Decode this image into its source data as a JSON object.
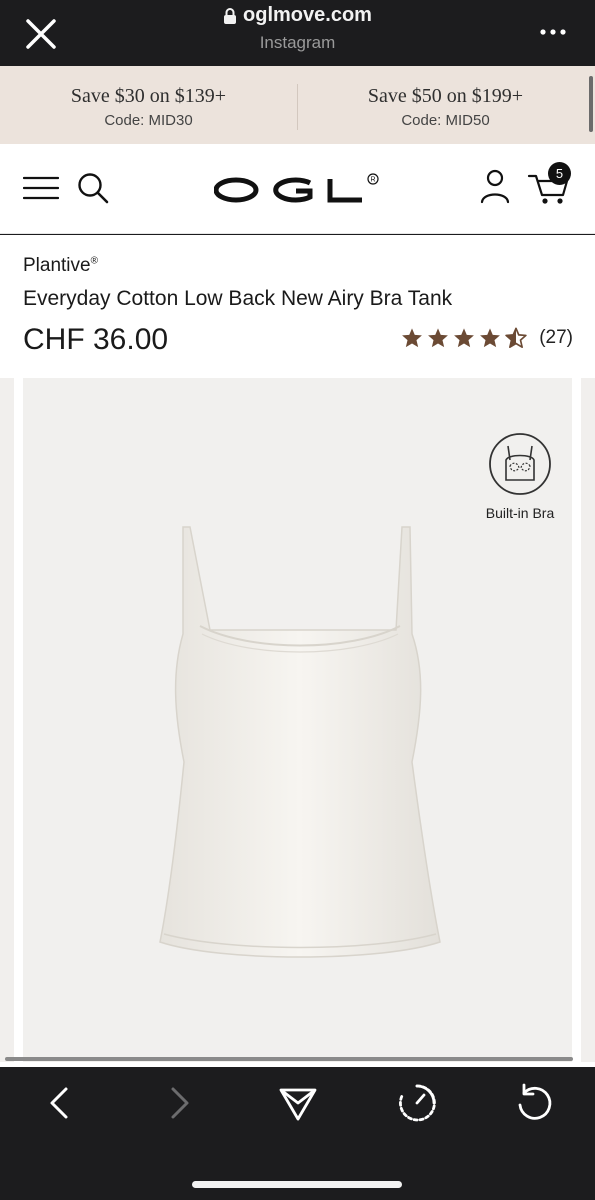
{
  "browser": {
    "url": "oglmove.com",
    "source": "Instagram"
  },
  "promo": [
    {
      "title": "Save $30 on $139+",
      "code": "Code: MID30"
    },
    {
      "title": "Save $50 on $199+",
      "code": "Code: MID50"
    }
  ],
  "header": {
    "logo": "OGL",
    "logo_mark": "®",
    "cart_count": "5"
  },
  "product": {
    "brand": "Plantive",
    "brand_mark": "®",
    "title": "Everyday Cotton Low Back New Airy Bra Tank",
    "price": "CHF 36.00",
    "rating": 4.5,
    "rating_count": "(27)",
    "badge_label": "Built-in Bra"
  },
  "colors": {
    "promo_bg": "#ece3dc",
    "star": "#6b4a34",
    "browser_chrome": "#1c1c1e",
    "image_bg": "#f1f0ee"
  },
  "icons": {
    "close": "close-icon",
    "lock": "lock-icon",
    "more": "more-icon",
    "menu": "hamburger-icon",
    "search": "search-icon",
    "account": "user-icon",
    "cart": "cart-icon",
    "back": "chevron-left-icon",
    "forward": "chevron-right-icon",
    "share": "share-icon",
    "timer": "timer-icon",
    "reload": "reload-icon"
  }
}
